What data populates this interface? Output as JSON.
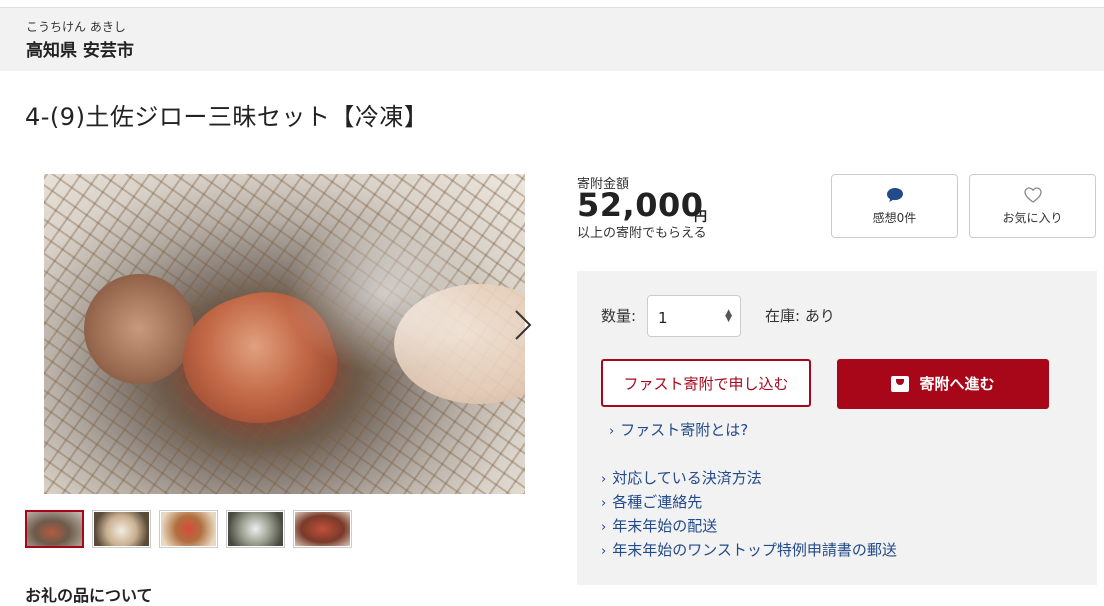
{
  "region": {
    "ruby": "こうちけん あきし",
    "name": "高知県 安芸市"
  },
  "product": {
    "title": "4-(9)土佐ジロー三昧セット【冷凍】"
  },
  "gallery": {
    "next_icon": "chevron-right-icon",
    "thumbnail_count": 5,
    "active_index": 0
  },
  "donation": {
    "label": "寄附金額",
    "amount": "52,000",
    "unit": "円",
    "note": "以上の寄附でもらえる"
  },
  "actions": {
    "review_label": "感想0件",
    "favorite_label": "お気に入り"
  },
  "order": {
    "quantity_label": "数量:",
    "quantity_value": "1",
    "stock_text": "在庫: あり",
    "fast_button": "ファスト寄附で申し込む",
    "donate_button": "寄附へ進む",
    "fast_link": "ファスト寄附とは?",
    "links": [
      "対応している決済方法",
      "各種ご連絡先",
      "年末年始の配送",
      "年末年始のワンストップ特例申請書の郵送"
    ]
  },
  "section": {
    "about_title": "お礼の品について"
  },
  "colors": {
    "accent": "#a8071a",
    "link": "#234a8a",
    "panel": "#f2f2f2"
  }
}
